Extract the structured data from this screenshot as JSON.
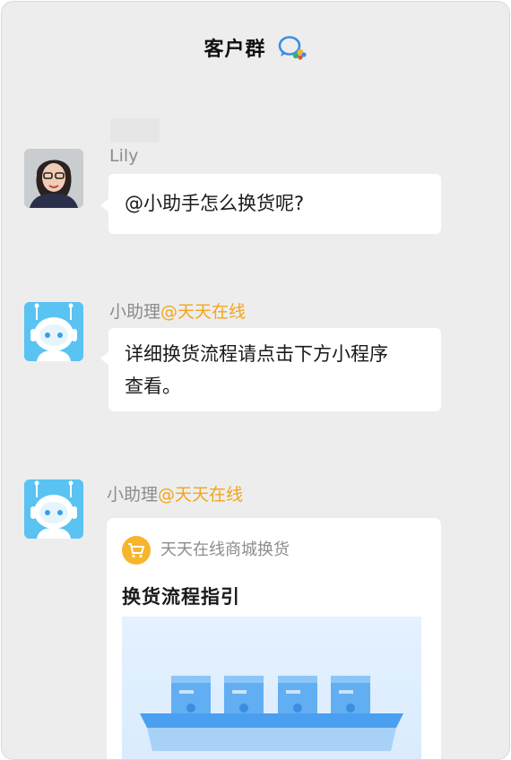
{
  "header": {
    "title": "客户群",
    "icon": "wecom-chat-icon"
  },
  "messages": [
    {
      "sender": "Lily",
      "text": "@小助手怎么换货呢?"
    },
    {
      "sender_name": "小助理",
      "sender_org": "@天天在线",
      "text_line1": "详细换货流程请点击下方小程序",
      "text_line2": "查看。"
    },
    {
      "sender_name": "小助理",
      "sender_org": "@天天在线",
      "card": {
        "app_name": "天天在线商城换货",
        "title": "换货流程指引",
        "app_icon": "shopping-cart-icon"
      }
    }
  ],
  "colors": {
    "background": "#ededed",
    "bubble": "#ffffff",
    "org_accent": "#f3a51a",
    "robot_blue": "#5ac3f1"
  }
}
